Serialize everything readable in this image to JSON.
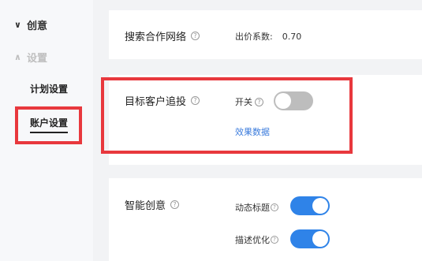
{
  "sidebar": {
    "groups": [
      {
        "label": "创意",
        "chevron": "chevron-down"
      },
      {
        "label": "设置",
        "chevron": "chevron-up"
      }
    ],
    "items": [
      {
        "label": "计划设置"
      },
      {
        "label": "账户设置",
        "active": true
      }
    ]
  },
  "search_network": {
    "label": "搜索合作网络",
    "bid_label": "出价系数:",
    "bid_value": "0.70"
  },
  "target_retargeting": {
    "label": "目标客户追投",
    "switch_label": "开关",
    "switch_on": false,
    "link": "效果数据"
  },
  "smart_creative": {
    "label": "智能创意",
    "options": [
      {
        "label": "动态标题",
        "on": true
      },
      {
        "label": "描述优化",
        "on": true
      }
    ]
  },
  "colors": {
    "highlight": "#e8383d",
    "toggle_on": "#2f83e8",
    "toggle_off": "#bdbdbd",
    "link": "#3a7bdc"
  },
  "icons": {
    "help": "question-circle-icon",
    "chevron_down": "chevron-down-icon",
    "chevron_up": "chevron-up-icon"
  }
}
